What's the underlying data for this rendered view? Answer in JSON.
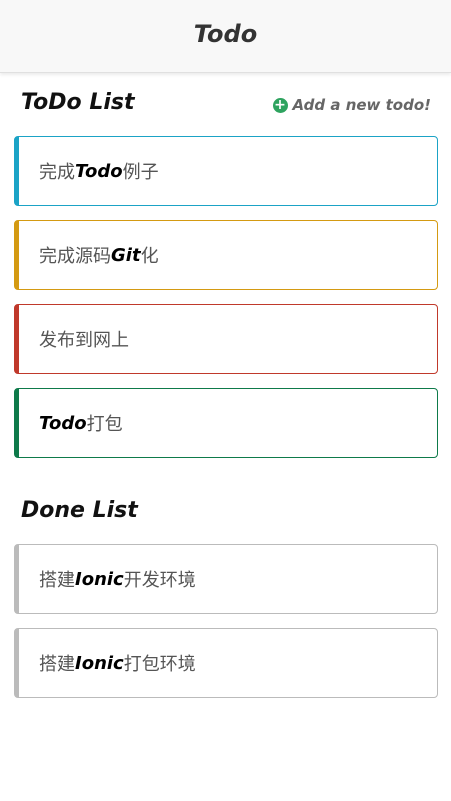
{
  "app": {
    "title": "Todo"
  },
  "todo_section": {
    "title": "ToDo List",
    "add_label": "Add a new todo!"
  },
  "todo_items": [
    {
      "pre": "完成",
      "bold": "Todo",
      "post": "例子",
      "color": "#1ba3c6"
    },
    {
      "pre": "完成源码",
      "bold": "Git",
      "post": "化",
      "color": "#d49a12"
    },
    {
      "pre": "发布到网上",
      "bold": "",
      "post": "",
      "color": "#c0392b"
    },
    {
      "pre": "",
      "bold": "Todo",
      "post": "打包",
      "color": "#0e7a4a"
    }
  ],
  "done_section": {
    "title": "Done List"
  },
  "done_items": [
    {
      "pre": "搭建",
      "bold": "Ionic",
      "post": "开发环境",
      "color": "#bbbbbb"
    },
    {
      "pre": "搭建",
      "bold": "Ionic",
      "post": "打包环境",
      "color": "#bbbbbb"
    }
  ]
}
